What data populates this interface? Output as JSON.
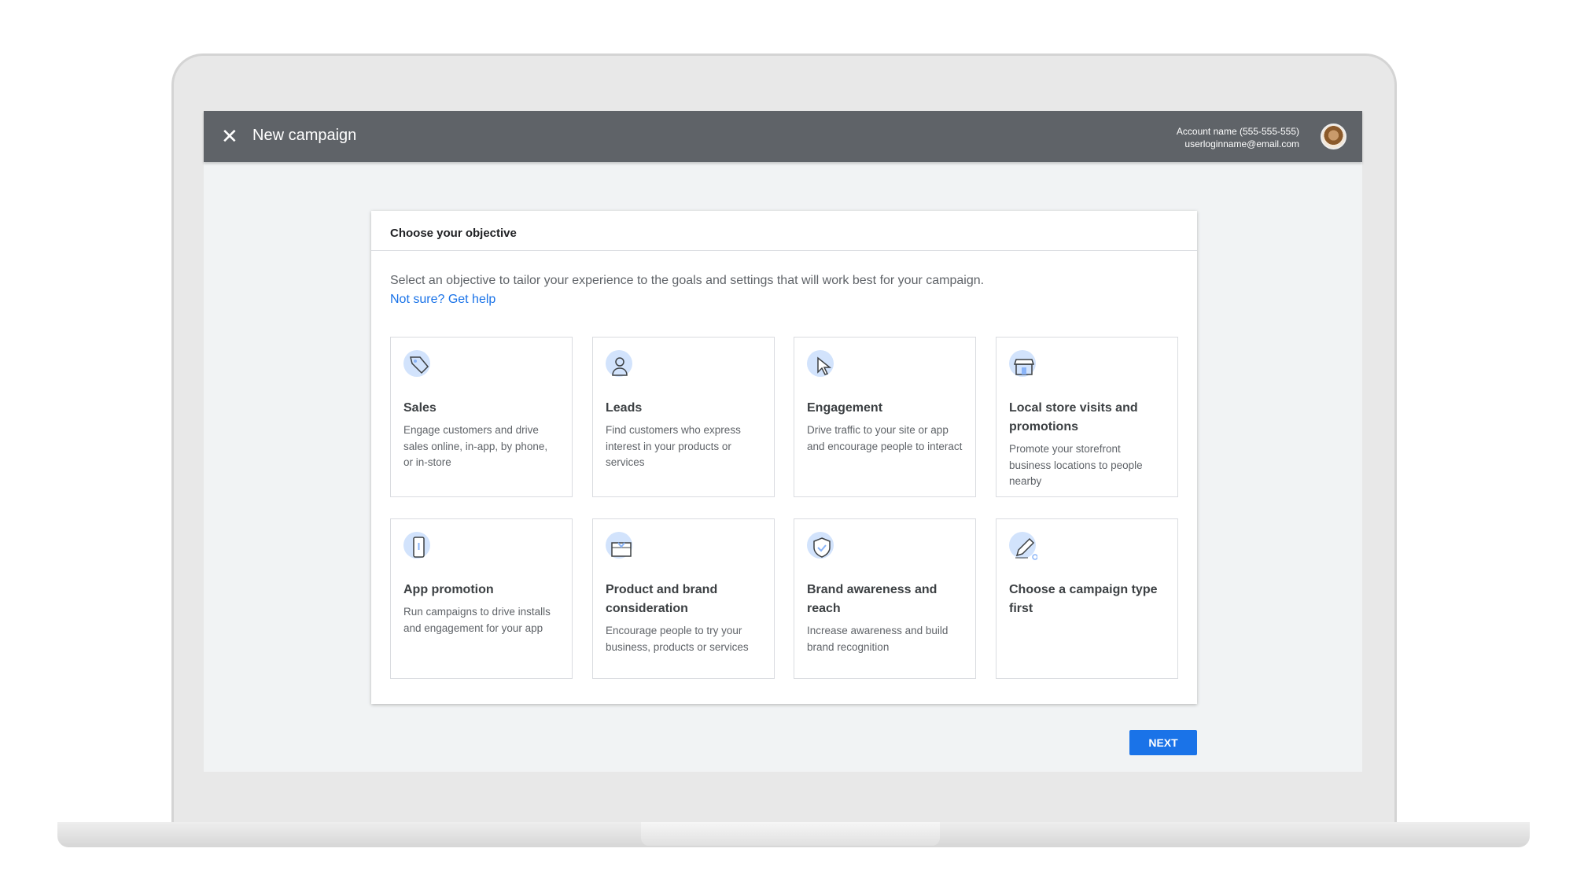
{
  "header": {
    "close_icon": "close-icon",
    "title": "New campaign",
    "account_name": "Account name (555-555-555)",
    "email": "userloginname@email.com"
  },
  "dialog": {
    "title": "Choose your objective",
    "intro": "Select an objective to tailor your experience to the goals and settings that will work best for your campaign.",
    "help_link": "Not sure? Get help"
  },
  "objectives": [
    {
      "icon": "tag-icon",
      "title": "Sales",
      "description": "Engage customers and drive sales online, in-app, by phone, or in-store"
    },
    {
      "icon": "person-icon",
      "title": "Leads",
      "description": "Find customers who express interest in your products or services"
    },
    {
      "icon": "cursor-icon",
      "title": "Engagement",
      "description": "Drive traffic to your site or app and encourage people to interact"
    },
    {
      "icon": "store-icon",
      "title": "Local store visits and promotions",
      "description": "Promote your storefront business locations to people nearby"
    },
    {
      "icon": "phone-icon",
      "title": "App promotion",
      "description": "Run campaigns to drive installs and engagement for your app"
    },
    {
      "icon": "gift-box-icon",
      "title": "Product and brand consideration",
      "description": "Encourage people to try your business, products or services"
    },
    {
      "icon": "shield-icon",
      "title": "Brand awareness and reach",
      "description": "Increase awareness and build brand recognition"
    },
    {
      "icon": "pencil-icon",
      "title": "Choose a campaign type first",
      "description": ""
    }
  ],
  "footer": {
    "next_label": "NEXT"
  },
  "colors": {
    "header": "#5f6368",
    "accent": "#1a73e8",
    "icon_bubble": "#d2e3fc"
  }
}
